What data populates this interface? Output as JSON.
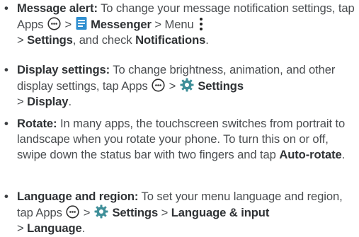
{
  "items": [
    {
      "head": "Message alert:",
      "t1": " To change your message notification settings, tap Apps ",
      "t2": " > ",
      "ui1": "Messenger",
      "t3": " > Menu ",
      "t4": "> ",
      "ui2": "Settings",
      "t5": ", and check ",
      "ui3": "Notifications",
      "t6": "."
    },
    {
      "head": "Display settings:",
      "t1": " To change brightness, animation, and other display settings, tap Apps ",
      "t2": " > ",
      "ui1": "Settings",
      "t3": "> ",
      "ui2": "Display",
      "t4": "."
    },
    {
      "head": "Rotate:",
      "t1": " In many apps, the touchscreen switches from portrait to landscape when you rotate your phone. To turn this on or off, swipe down the status bar with two fingers and tap ",
      "ui1": "Auto-rotate",
      "t2": "."
    },
    {
      "head": "Language and region:",
      "t1": " To set your menu language and region, tap Apps ",
      "t2": " > ",
      "ui1": "Settings",
      "t3": " > ",
      "ui2": "Language & input",
      "t4": "> ",
      "ui3": "Language",
      "t5": "."
    }
  ],
  "icons": {
    "apps": "apps-icon",
    "messenger": "messenger-icon",
    "menu": "menu-overflow-icon",
    "settings": "settings-gear-icon"
  },
  "colors": {
    "text": "#4a4d50",
    "bold_text": "#2f3235",
    "messenger_blue": "#2f8fd0",
    "gear_teal": "#3f8f99"
  }
}
